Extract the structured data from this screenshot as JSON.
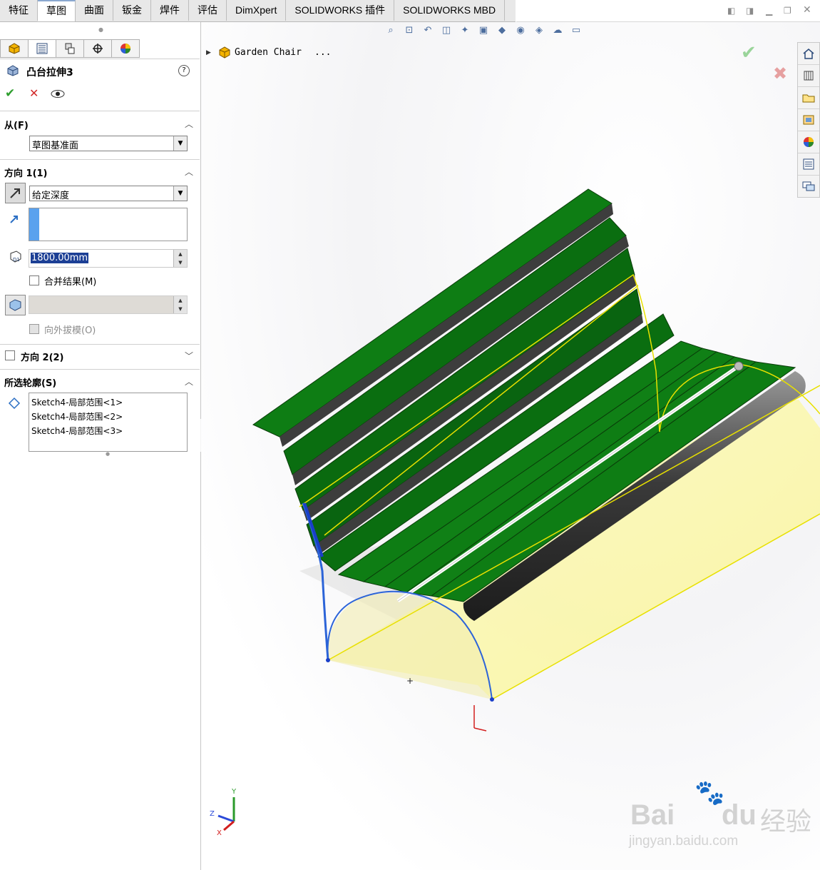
{
  "tabs": [
    "特征",
    "草图",
    "曲面",
    "钣金",
    "焊件",
    "评估",
    "DimXpert",
    "SOLIDWORKS 插件",
    "SOLIDWORKS MBD"
  ],
  "active_tab_index": 1,
  "panel": {
    "title": "凸台拉伸3",
    "help_icon": "?",
    "sections": {
      "from": {
        "header": "从(F)",
        "value": "草图基准面"
      },
      "direction1": {
        "header": "方向 1(1)",
        "end_condition": "给定深度",
        "depth": "1800.00mm",
        "merge_label": "合并结果(M)",
        "draft_out_label": "向外拔模(O)"
      },
      "direction2": {
        "header": "方向 2(2)"
      },
      "contours": {
        "header": "所选轮廓(S)",
        "items": [
          "Sketch4-局部范围<1>",
          "Sketch4-局部范围<2>",
          "Sketch4-局部范围<3>"
        ]
      }
    }
  },
  "tree": {
    "part_name": "Garden Chair",
    "ellipsis": "..."
  },
  "triad": {
    "y": "Y",
    "z": "Z",
    "x": "X"
  },
  "watermark": {
    "brand": "Bai",
    "brand2": "du",
    "cn": "经验",
    "url": "jingyan.baidu.com"
  },
  "colors": {
    "slat": "#0d7a12",
    "slat_dark": "#07600a",
    "sketch_blue": "#2c64d8",
    "preview_yellow": "#f4f05a",
    "accent_ok": "#2e9e2e",
    "accent_cancel": "#d22a2a"
  }
}
